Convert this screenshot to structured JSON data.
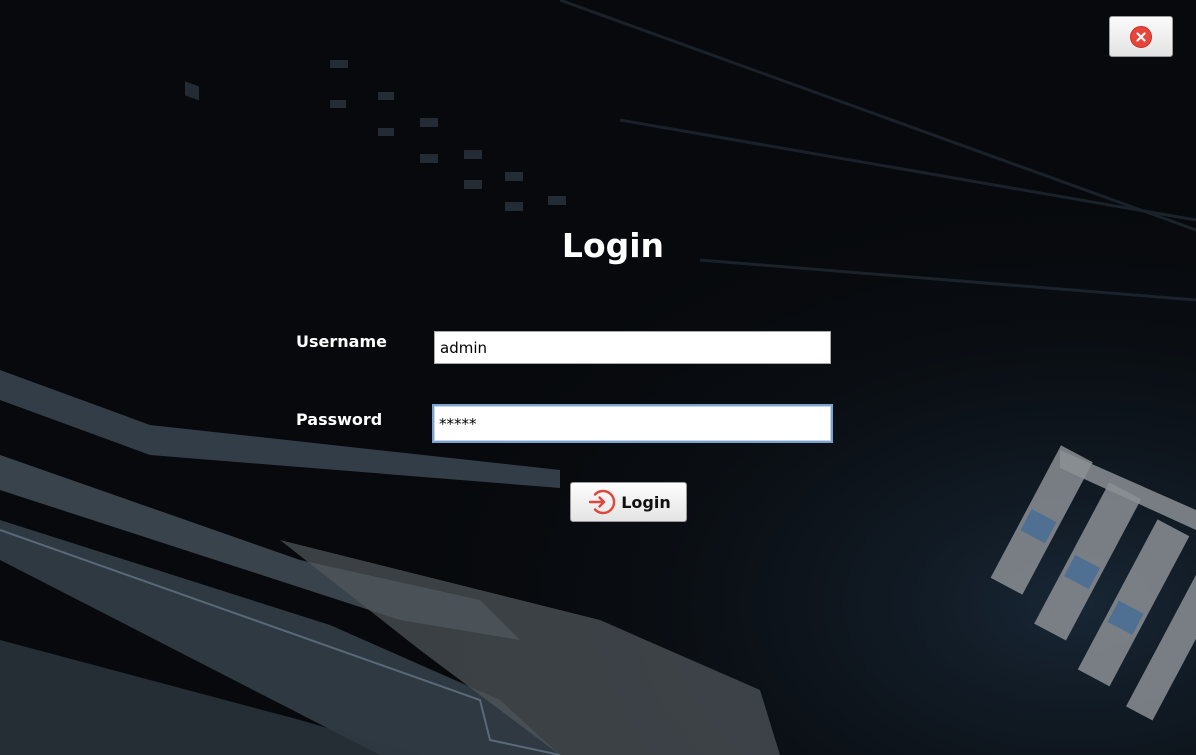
{
  "window": {
    "close_icon": "close-icon",
    "accent_color": "#e8443a"
  },
  "form": {
    "title": "Login",
    "username_label": "Username",
    "username_value": "admin",
    "password_label": "Password",
    "password_value": "*****",
    "login_label": "Login",
    "login_icon": "login-arrow-icon"
  }
}
